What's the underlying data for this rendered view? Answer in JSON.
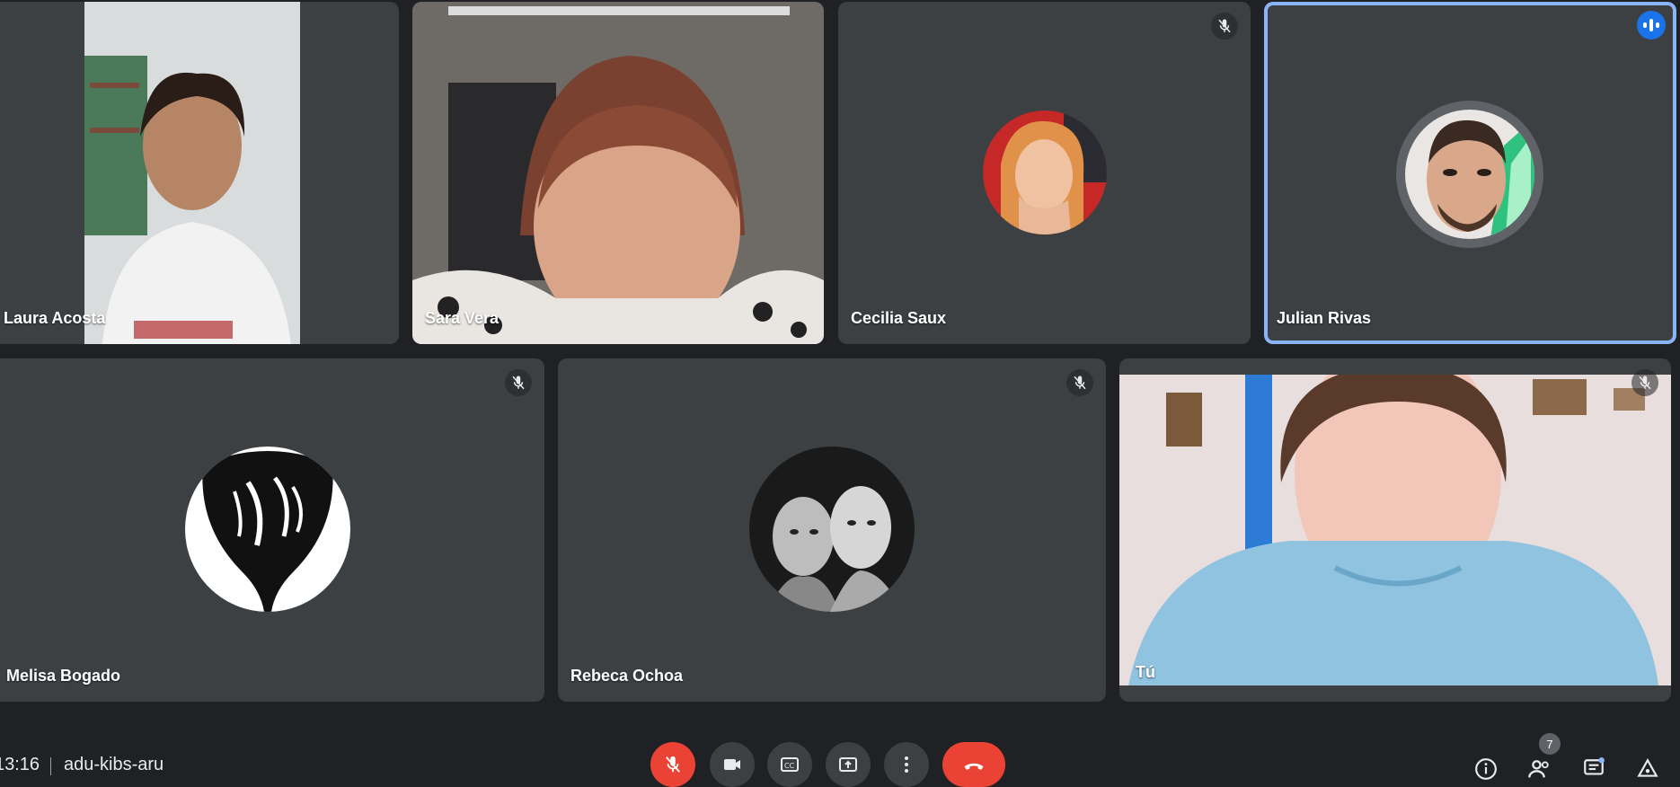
{
  "participants": [
    {
      "name": "Laura Acosta",
      "muted": false
    },
    {
      "name": "Sara Vera",
      "muted": false
    },
    {
      "name": "Cecilia Saux",
      "muted": true
    },
    {
      "name": "Julian Rivas",
      "muted": false,
      "speaking": true
    },
    {
      "name": "Melisa Bogado",
      "muted": true
    },
    {
      "name": "Rebeca Ochoa",
      "muted": true
    },
    {
      "name": "Tú",
      "muted": true
    }
  ],
  "meeting": {
    "time": "13:16",
    "code": "adu-kibs-aru"
  },
  "controls": {
    "mic": "mic-off-icon",
    "camera": "camera-icon",
    "captions": "captions-icon",
    "present": "present-icon",
    "more": "more-options-icon",
    "leave": "end-call-icon"
  },
  "right_panel": {
    "people_count": "7"
  },
  "colors": {
    "background": "#202124",
    "tile": "#3c4043",
    "speaking_border": "#8ab4f8",
    "leave": "#ea4335",
    "speak_indicator": "#1a73e8"
  }
}
